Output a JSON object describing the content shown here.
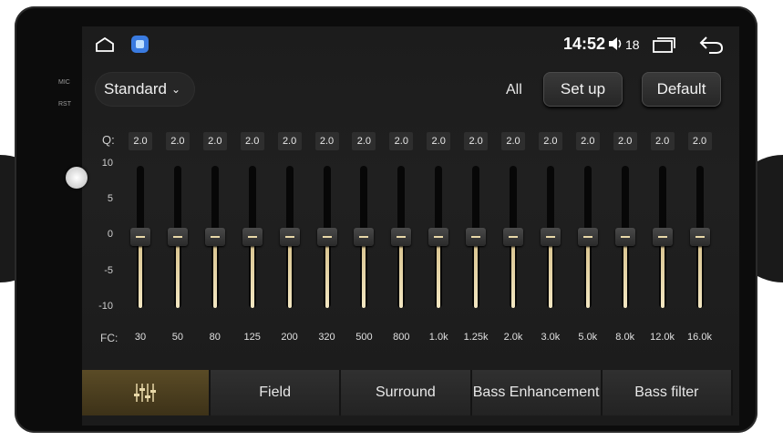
{
  "side": {
    "mic": "MIC",
    "rst": "RST"
  },
  "status": {
    "time": "14:52",
    "volume": "18"
  },
  "controls": {
    "preset": "Standard",
    "all": "All",
    "setup": "Set up",
    "default": "Default"
  },
  "eq": {
    "q_label": "Q:",
    "fc_label": "FC:",
    "scale": [
      "10",
      "5",
      "0",
      "-5",
      "-10"
    ],
    "bands": [
      {
        "fc": "30",
        "q": "2.0",
        "gain": 0
      },
      {
        "fc": "50",
        "q": "2.0",
        "gain": 0
      },
      {
        "fc": "80",
        "q": "2.0",
        "gain": 0
      },
      {
        "fc": "125",
        "q": "2.0",
        "gain": 0
      },
      {
        "fc": "200",
        "q": "2.0",
        "gain": 0
      },
      {
        "fc": "320",
        "q": "2.0",
        "gain": 0
      },
      {
        "fc": "500",
        "q": "2.0",
        "gain": 0
      },
      {
        "fc": "800",
        "q": "2.0",
        "gain": 0
      },
      {
        "fc": "1.0k",
        "q": "2.0",
        "gain": 0
      },
      {
        "fc": "1.25k",
        "q": "2.0",
        "gain": 0
      },
      {
        "fc": "2.0k",
        "q": "2.0",
        "gain": 0
      },
      {
        "fc": "3.0k",
        "q": "2.0",
        "gain": 0
      },
      {
        "fc": "5.0k",
        "q": "2.0",
        "gain": 0
      },
      {
        "fc": "8.0k",
        "q": "2.0",
        "gain": 0
      },
      {
        "fc": "12.0k",
        "q": "2.0",
        "gain": 0
      },
      {
        "fc": "16.0k",
        "q": "2.0",
        "gain": 0
      }
    ]
  },
  "tabs": [
    {
      "label": "",
      "icon": "equalizer-icon"
    },
    {
      "label": "Field"
    },
    {
      "label": "Surround"
    },
    {
      "label": "Bass Enhancement"
    },
    {
      "label": "Bass filter"
    }
  ],
  "colors": {
    "accent": "#5a4b26",
    "fill": "#e6d5a5"
  }
}
